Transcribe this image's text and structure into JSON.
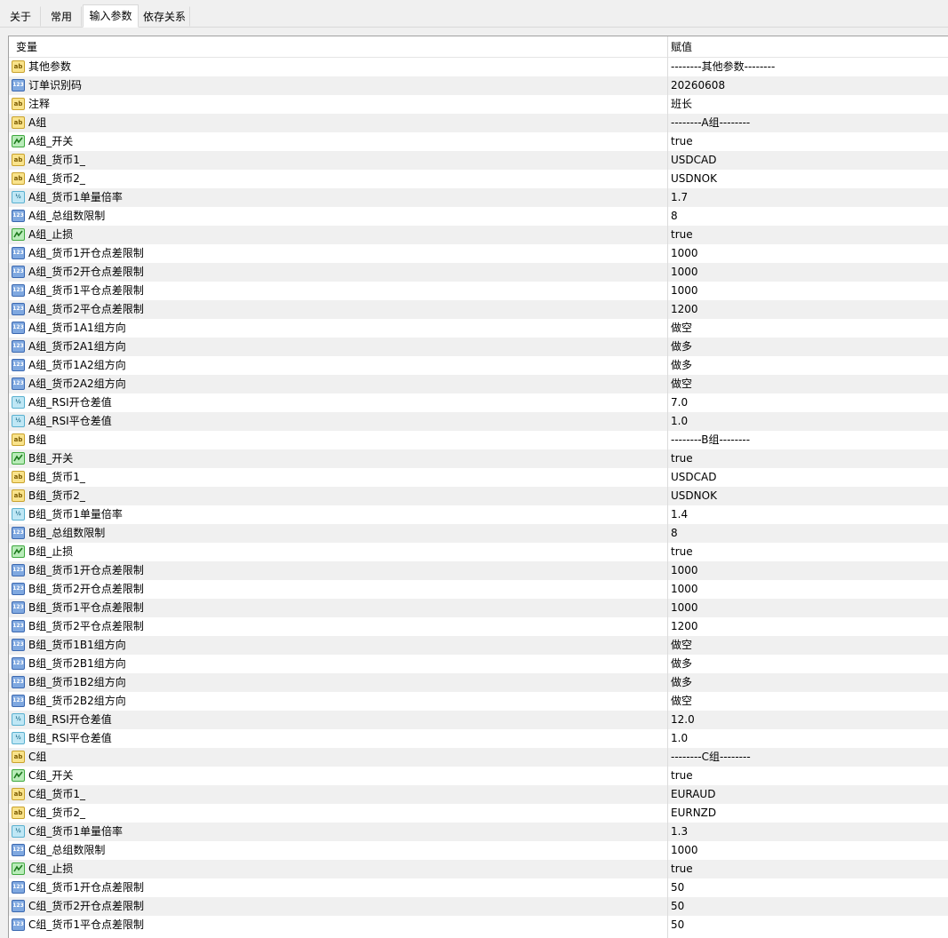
{
  "tabs": [
    {
      "label": "关于",
      "active": false
    },
    {
      "label": "常用",
      "active": false
    },
    {
      "label": "输入参数",
      "active": true
    },
    {
      "label": "依存关系",
      "active": false
    }
  ],
  "columns": {
    "name": "变量",
    "value": "赋值"
  },
  "icon_types": {
    "ab": "string-type-icon",
    "int": "integer-type-icon",
    "bool": "boolean-type-icon",
    "dbl": "double-type-icon"
  },
  "rows": [
    {
      "type": "ab",
      "name": "其他参数",
      "value": "--------其他参数--------"
    },
    {
      "type": "int",
      "name": "订单识别码",
      "value": "20260608"
    },
    {
      "type": "ab",
      "name": "注释",
      "value": "班长"
    },
    {
      "type": "ab",
      "name": "A组",
      "value": "--------A组--------"
    },
    {
      "type": "bool",
      "name": "A组_开关",
      "value": "true"
    },
    {
      "type": "ab",
      "name": "A组_货币1_",
      "value": "USDCAD"
    },
    {
      "type": "ab",
      "name": "A组_货币2_",
      "value": "USDNOK"
    },
    {
      "type": "dbl",
      "name": "A组_货币1单量倍率",
      "value": "1.7"
    },
    {
      "type": "int",
      "name": "A组_总组数限制",
      "value": "8"
    },
    {
      "type": "bool",
      "name": "A组_止损",
      "value": "true"
    },
    {
      "type": "int",
      "name": "A组_货币1开仓点差限制",
      "value": "1000"
    },
    {
      "type": "int",
      "name": "A组_货币2开仓点差限制",
      "value": "1000"
    },
    {
      "type": "int",
      "name": "A组_货币1平仓点差限制",
      "value": "1000"
    },
    {
      "type": "int",
      "name": "A组_货币2平仓点差限制",
      "value": "1200"
    },
    {
      "type": "int",
      "name": "A组_货币1A1组方向",
      "value": "做空"
    },
    {
      "type": "int",
      "name": "A组_货币2A1组方向",
      "value": "做多"
    },
    {
      "type": "int",
      "name": "A组_货币1A2组方向",
      "value": "做多"
    },
    {
      "type": "int",
      "name": "A组_货币2A2组方向",
      "value": "做空"
    },
    {
      "type": "dbl",
      "name": "A组_RSI开仓差值",
      "value": "7.0"
    },
    {
      "type": "dbl",
      "name": "A组_RSI平仓差值",
      "value": "1.0"
    },
    {
      "type": "ab",
      "name": "B组",
      "value": "--------B组--------"
    },
    {
      "type": "bool",
      "name": "B组_开关",
      "value": "true"
    },
    {
      "type": "ab",
      "name": "B组_货币1_",
      "value": "USDCAD"
    },
    {
      "type": "ab",
      "name": "B组_货币2_",
      "value": "USDNOK"
    },
    {
      "type": "dbl",
      "name": "B组_货币1单量倍率",
      "value": "1.4"
    },
    {
      "type": "int",
      "name": "B组_总组数限制",
      "value": "8"
    },
    {
      "type": "bool",
      "name": "B组_止损",
      "value": "true"
    },
    {
      "type": "int",
      "name": "B组_货币1开仓点差限制",
      "value": "1000"
    },
    {
      "type": "int",
      "name": "B组_货币2开仓点差限制",
      "value": "1000"
    },
    {
      "type": "int",
      "name": "B组_货币1平仓点差限制",
      "value": "1000"
    },
    {
      "type": "int",
      "name": "B组_货币2平仓点差限制",
      "value": "1200"
    },
    {
      "type": "int",
      "name": "B组_货币1B1组方向",
      "value": "做空"
    },
    {
      "type": "int",
      "name": "B组_货币2B1组方向",
      "value": "做多"
    },
    {
      "type": "int",
      "name": "B组_货币1B2组方向",
      "value": "做多"
    },
    {
      "type": "int",
      "name": "B组_货币2B2组方向",
      "value": "做空"
    },
    {
      "type": "dbl",
      "name": "B组_RSI开仓差值",
      "value": "12.0"
    },
    {
      "type": "dbl",
      "name": "B组_RSI平仓差值",
      "value": "1.0"
    },
    {
      "type": "ab",
      "name": "C组",
      "value": "--------C组--------"
    },
    {
      "type": "bool",
      "name": "C组_开关",
      "value": "true"
    },
    {
      "type": "ab",
      "name": "C组_货币1_",
      "value": "EURAUD"
    },
    {
      "type": "ab",
      "name": "C组_货币2_",
      "value": "EURNZD"
    },
    {
      "type": "dbl",
      "name": "C组_货币1单量倍率",
      "value": "1.3"
    },
    {
      "type": "int",
      "name": "C组_总组数限制",
      "value": "1000"
    },
    {
      "type": "bool",
      "name": "C组_止损",
      "value": "true"
    },
    {
      "type": "int",
      "name": "C组_货币1开仓点差限制",
      "value": "50"
    },
    {
      "type": "int",
      "name": "C组_货币2开仓点差限制",
      "value": "50"
    },
    {
      "type": "int",
      "name": "C组_货币1平仓点差限制",
      "value": "50"
    }
  ]
}
